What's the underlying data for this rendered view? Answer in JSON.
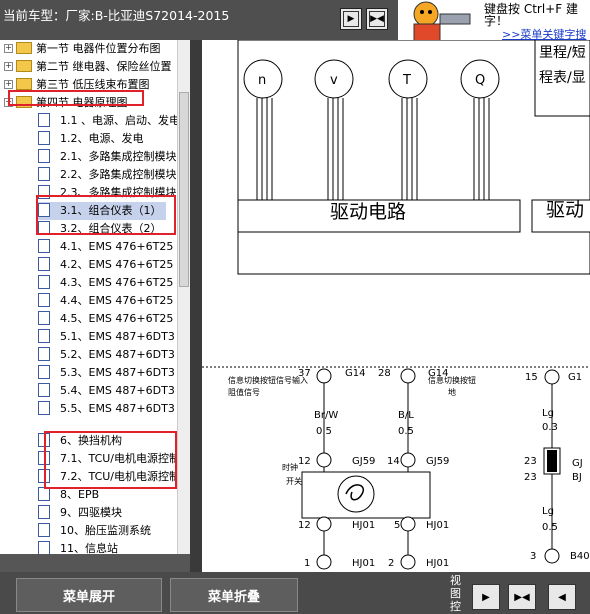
{
  "app": {
    "title": "当前车型：厂家:B-比亚迪S72014-2015",
    "nav_buttons": [
      {
        "icon": "next-icon"
      },
      {
        "icon": "collapse-icon"
      }
    ],
    "helper": {
      "line1": "键盘按 Ctrl+F 建",
      "line2": "字！",
      "link": ">>菜单关键字搜"
    }
  },
  "tree": {
    "items": [
      {
        "label": "第一节 电器件位置分布图"
      },
      {
        "label": "第二节 继电器、保险丝位置"
      },
      {
        "label": "第三节 低压线束布置图"
      },
      {
        "label": "第四节 电器原理图"
      },
      {
        "label": "1.1 、电源、启动、发电"
      },
      {
        "label": "1.2、电源、发电"
      },
      {
        "label": "2.1、多路集成控制模块"
      },
      {
        "label": "2.2、多路集成控制模块"
      },
      {
        "label": "2.3、多路集成控制模块"
      },
      {
        "label": "3.1、组合仪表（1）"
      },
      {
        "label": "3.2、组合仪表（2）"
      },
      {
        "label": "4.1、EMS 476+6T25"
      },
      {
        "label": "4.2、EMS 476+6T25"
      },
      {
        "label": "4.3、EMS 476+6T25"
      },
      {
        "label": "4.4、EMS 476+6T25"
      },
      {
        "label": "4.5、EMS 476+6T25"
      },
      {
        "label": "5.1、EMS 487+6DT3"
      },
      {
        "label": "5.2、EMS 487+6DT3"
      },
      {
        "label": "5.3、EMS 487+6DT3"
      },
      {
        "label": "5.4、EMS 487+6DT3"
      },
      {
        "label": "5.5、EMS 487+6DT3"
      },
      {
        "label": "6、换挡机构"
      },
      {
        "label": "7.1、TCU/电机电源控制"
      },
      {
        "label": "7.2、TCU/电机电源控制"
      },
      {
        "label": "8、EPB"
      },
      {
        "label": "9、四驱模块"
      },
      {
        "label": "10、胎压监测系统"
      },
      {
        "label": "11、信息站"
      }
    ]
  },
  "diagram": {
    "top_right_1": "里程/短",
    "top_right_2": "程表/显",
    "gauges": [
      "n",
      "v",
      "T",
      "Q"
    ],
    "drive_circuit": "驱动电路",
    "drive_circuit_2": "驱动",
    "pin_37": "37",
    "pin_g14a": "G14",
    "pin_28": "28",
    "pin_g14b": "G14",
    "pin_15": "15",
    "pin_g1": "G1",
    "sig_left_1": "信息切换按钮信号输入",
    "sig_left_2": "阻值信号",
    "sig_mid_1": "信息切换按钮",
    "sig_mid_2": "地",
    "wire_brw": "Br/W",
    "wire_brw_size": "0.5",
    "wire_bl": "B/L",
    "wire_bl_size": "0.5",
    "wire_lg": "Lg",
    "wire_lg_size": "0.3",
    "pin_12a": "12",
    "pin_gj59a": "GJ59",
    "pin_14a": "14",
    "pin_gj59b": "GJ59",
    "switch_label_1": "时钟",
    "switch_label_2": "开关",
    "pin_23a": "23",
    "pin_gj_r": "GJ",
    "pin_23b": "23",
    "pin_bj": "BJ",
    "pin_12b": "12",
    "pin_hj01a": "HJ01",
    "pin_5": "5",
    "pin_hj01b": "HJ01",
    "wire_lg2": "Lg",
    "wire_lg2_size": "0.5",
    "pin_1": "1",
    "pin_hj01c": "HJ01",
    "pin_2": "2",
    "pin_hj01d": "HJ01",
    "pin_3": "3",
    "pin_b40": "B40"
  },
  "bottom": {
    "expand_label": "菜单展开",
    "collapse_label": "菜单折叠",
    "view_label": "视图控",
    "icons": [
      "next-icon",
      "collapse-icon",
      "prev-icon"
    ]
  }
}
